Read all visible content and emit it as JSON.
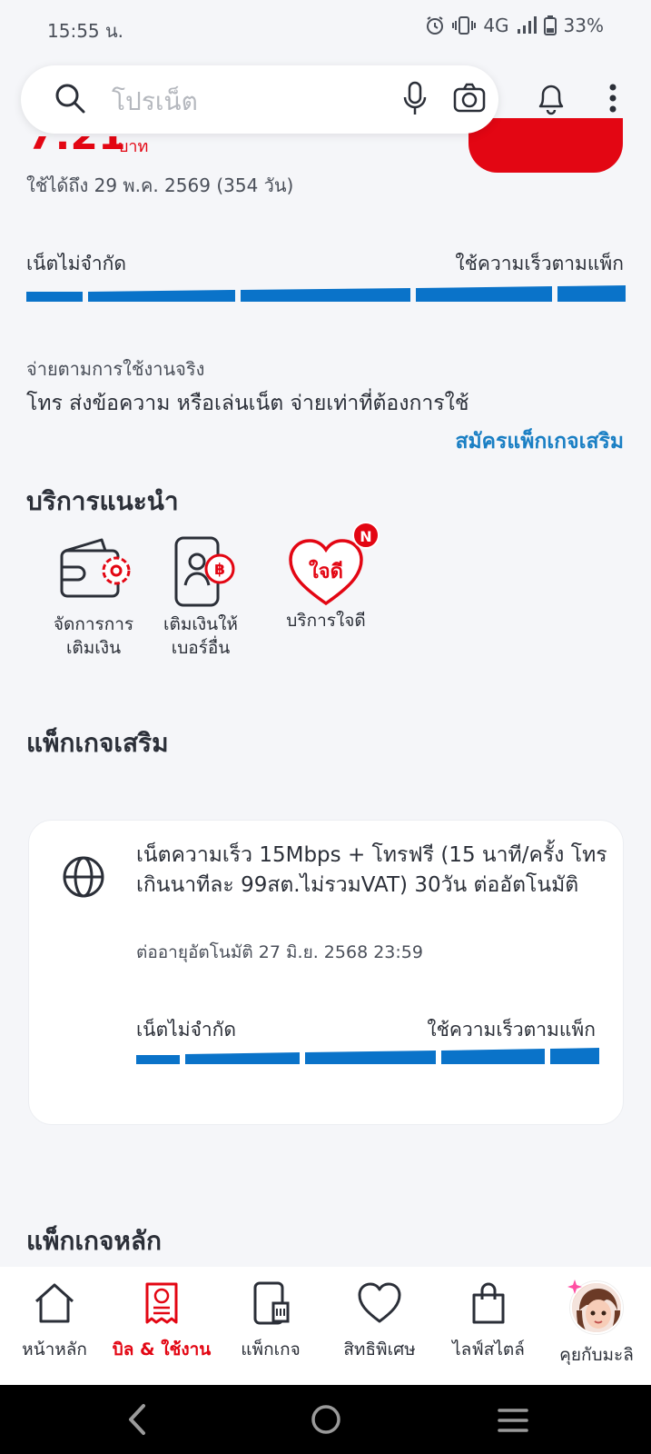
{
  "status_bar": {
    "time": "15:55 น.",
    "network": "4G",
    "battery": "33%"
  },
  "search": {
    "placeholder": "โปรเน็ต"
  },
  "balance": {
    "amount_partial": "7.21",
    "unit": "บาท",
    "valid_until": "ใช้ได้ถึง 29 พ.ค. 2569 (354 วัน)"
  },
  "main_speed": {
    "left_label": "เน็ตไม่จำกัด",
    "right_label": "ใช้ความเร็วตามแพ็ก"
  },
  "payg": {
    "title": "จ่ายตามการใช้งานจริง",
    "description": "โทร ส่งข้อความ หรือเล่นเน็ต จ่ายเท่าที่ต้องการใช้",
    "link": "สมัครแพ็กเกจเสริม"
  },
  "recommended": {
    "title": "บริการแนะนำ",
    "items": [
      {
        "label": "จัดการการ\nเติมเงิน",
        "icon": "wallet-gear-icon"
      },
      {
        "label": "เติมเงินให้\nเบอร์อื่น",
        "icon": "phone-baht-icon"
      },
      {
        "label": "บริการใจดี",
        "icon": "jaidee-heart-icon",
        "logo_text": "ใจดี",
        "badge": "N"
      }
    ]
  },
  "addon": {
    "title": "แพ็กเกจเสริม",
    "name": "เน็ตความเร็ว 15Mbps + โทรฟรี (15 นาที/ครั้ง โทรเกินนาทีละ 99สต.ไม่รวมVAT) 30วัน ต่ออัตโนมัติ",
    "renew": "ต่ออายุอัตโนมัติ 27 มิ.ย. 2568 23:59",
    "left_label": "เน็ตไม่จำกัด",
    "right_label": "ใช้ความเร็วตามแพ็ก"
  },
  "main_package": {
    "title": "แพ็กเกจหลัก"
  },
  "bottom_nav": [
    {
      "label": "หน้าหลัก",
      "icon": "home-icon",
      "active": false
    },
    {
      "label": "บิล & ใช้งาน",
      "icon": "bill-icon",
      "active": true
    },
    {
      "label": "แพ็กเกจ",
      "icon": "sim-phone-icon",
      "active": false
    },
    {
      "label": "สิทธิพิเศษ",
      "icon": "heart-icon",
      "active": false
    },
    {
      "label": "ไลฟ์สไตล์",
      "icon": "shopping-bag-icon",
      "active": false
    },
    {
      "label": "คุยกับมะลิ",
      "icon": "avatar",
      "active": false
    }
  ],
  "colors": {
    "brand_red": "#e30613",
    "speed_blue": "#0a73c9",
    "link_blue": "#1a7fc4"
  }
}
